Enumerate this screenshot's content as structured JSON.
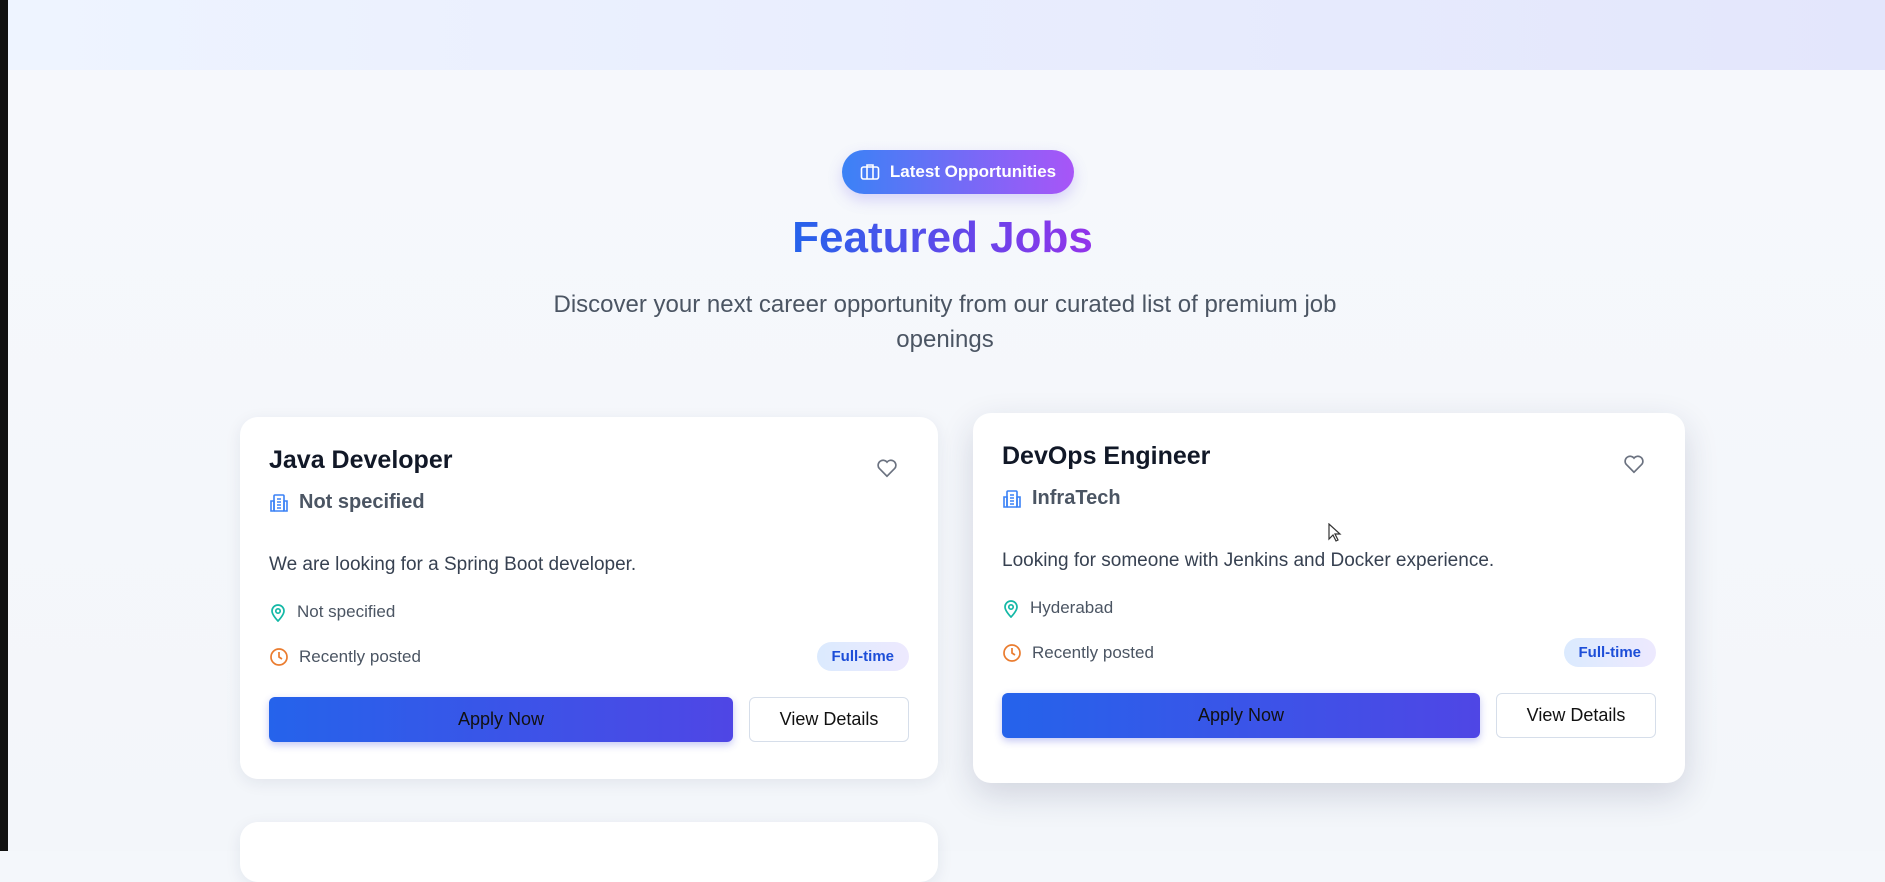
{
  "section": {
    "badge_label": "Latest Opportunities",
    "title": "Featured Jobs",
    "subtitle": "Discover your next career opportunity from our curated list of premium job openings"
  },
  "jobs": [
    {
      "title": "Java Developer",
      "company": "Not specified",
      "description": "We are looking for a Spring Boot developer.",
      "location": "Not specified",
      "posted": "Recently posted",
      "type": "Full-time",
      "apply_label": "Apply Now",
      "details_label": "View Details"
    },
    {
      "title": "DevOps Engineer",
      "company": "InfraTech",
      "description": "Looking for someone with Jenkins and Docker experience.",
      "location": "Hyderabad",
      "posted": "Recently posted",
      "type": "Full-time",
      "apply_label": "Apply Now",
      "details_label": "View Details"
    }
  ],
  "colors": {
    "accent_start": "#2563eb",
    "accent_end": "#9333ea",
    "location_icon": "#14b8a6",
    "clock_icon": "#ea7c2f"
  }
}
